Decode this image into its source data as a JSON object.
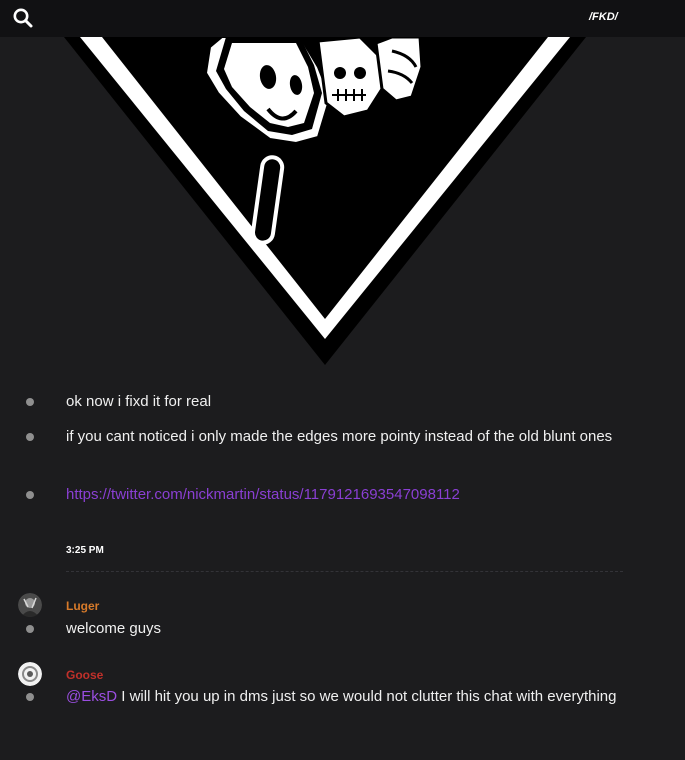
{
  "header": {
    "channel": "/FKD/",
    "search_icon": "search-icon"
  },
  "messages": [
    {
      "text": "ok now i fixd it for real"
    },
    {
      "text": "if you cant noticed i only made the edges more pointy instead of the old blunt ones"
    },
    {
      "link": "https://twitter.com/nickmartin/status/1179121693547098112"
    }
  ],
  "timestamp": "3:25 PM",
  "luger": {
    "username": "Luger",
    "color": "#d77a2a",
    "text": "welcome guys"
  },
  "goose": {
    "username": "Goose",
    "color": "#c0302a",
    "mention": "@EksD",
    "text": " I will hit you up in dms just so we would not clutter this chat with everything"
  },
  "colors": {
    "background": "#1c1c1e",
    "topbar": "#111113",
    "link": "#8a3fd3",
    "bullet": "#8f8f8f"
  }
}
